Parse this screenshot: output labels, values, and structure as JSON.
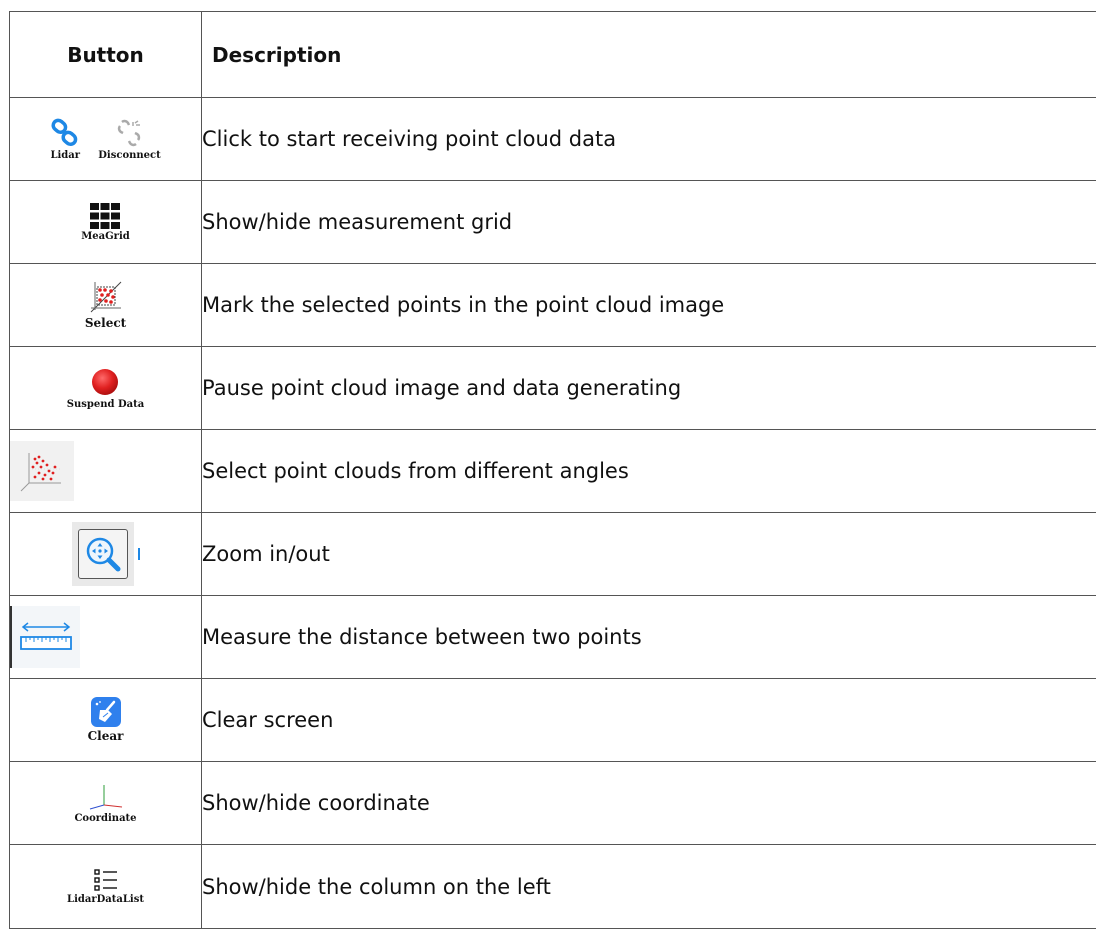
{
  "header": {
    "button": "Button",
    "description": "Description"
  },
  "rows": [
    {
      "icon": "link-icon",
      "captions": [
        "Lidar",
        "Disconnect"
      ],
      "description": "Click to start receiving point cloud data"
    },
    {
      "icon": "grid-icon",
      "caption": "MeaGrid",
      "description": "Show/hide measurement grid"
    },
    {
      "icon": "select-points-icon",
      "caption": "Select",
      "description": "Mark the selected points in the point cloud image"
    },
    {
      "icon": "red-dot-icon",
      "caption": "Suspend Data",
      "description": "Pause point cloud image and data generating"
    },
    {
      "icon": "point-cloud-angle-icon",
      "description": "Select point clouds from different angles"
    },
    {
      "icon": "zoom-icon",
      "description": "Zoom in/out"
    },
    {
      "icon": "ruler-icon",
      "description": "Measure the distance between two points"
    },
    {
      "icon": "broom-icon",
      "caption": "Clear",
      "description": "Clear screen"
    },
    {
      "icon": "axes-icon",
      "caption": "Coordinate",
      "description": "Show/hide coordinate"
    },
    {
      "icon": "list-icon",
      "caption": "LidarDataList",
      "description": "Show/hide the column on the left"
    }
  ],
  "colors": {
    "link_blue": "#1e88e5",
    "red": "#e02020",
    "clear_blue": "#2f80ed",
    "border": "#555555"
  }
}
